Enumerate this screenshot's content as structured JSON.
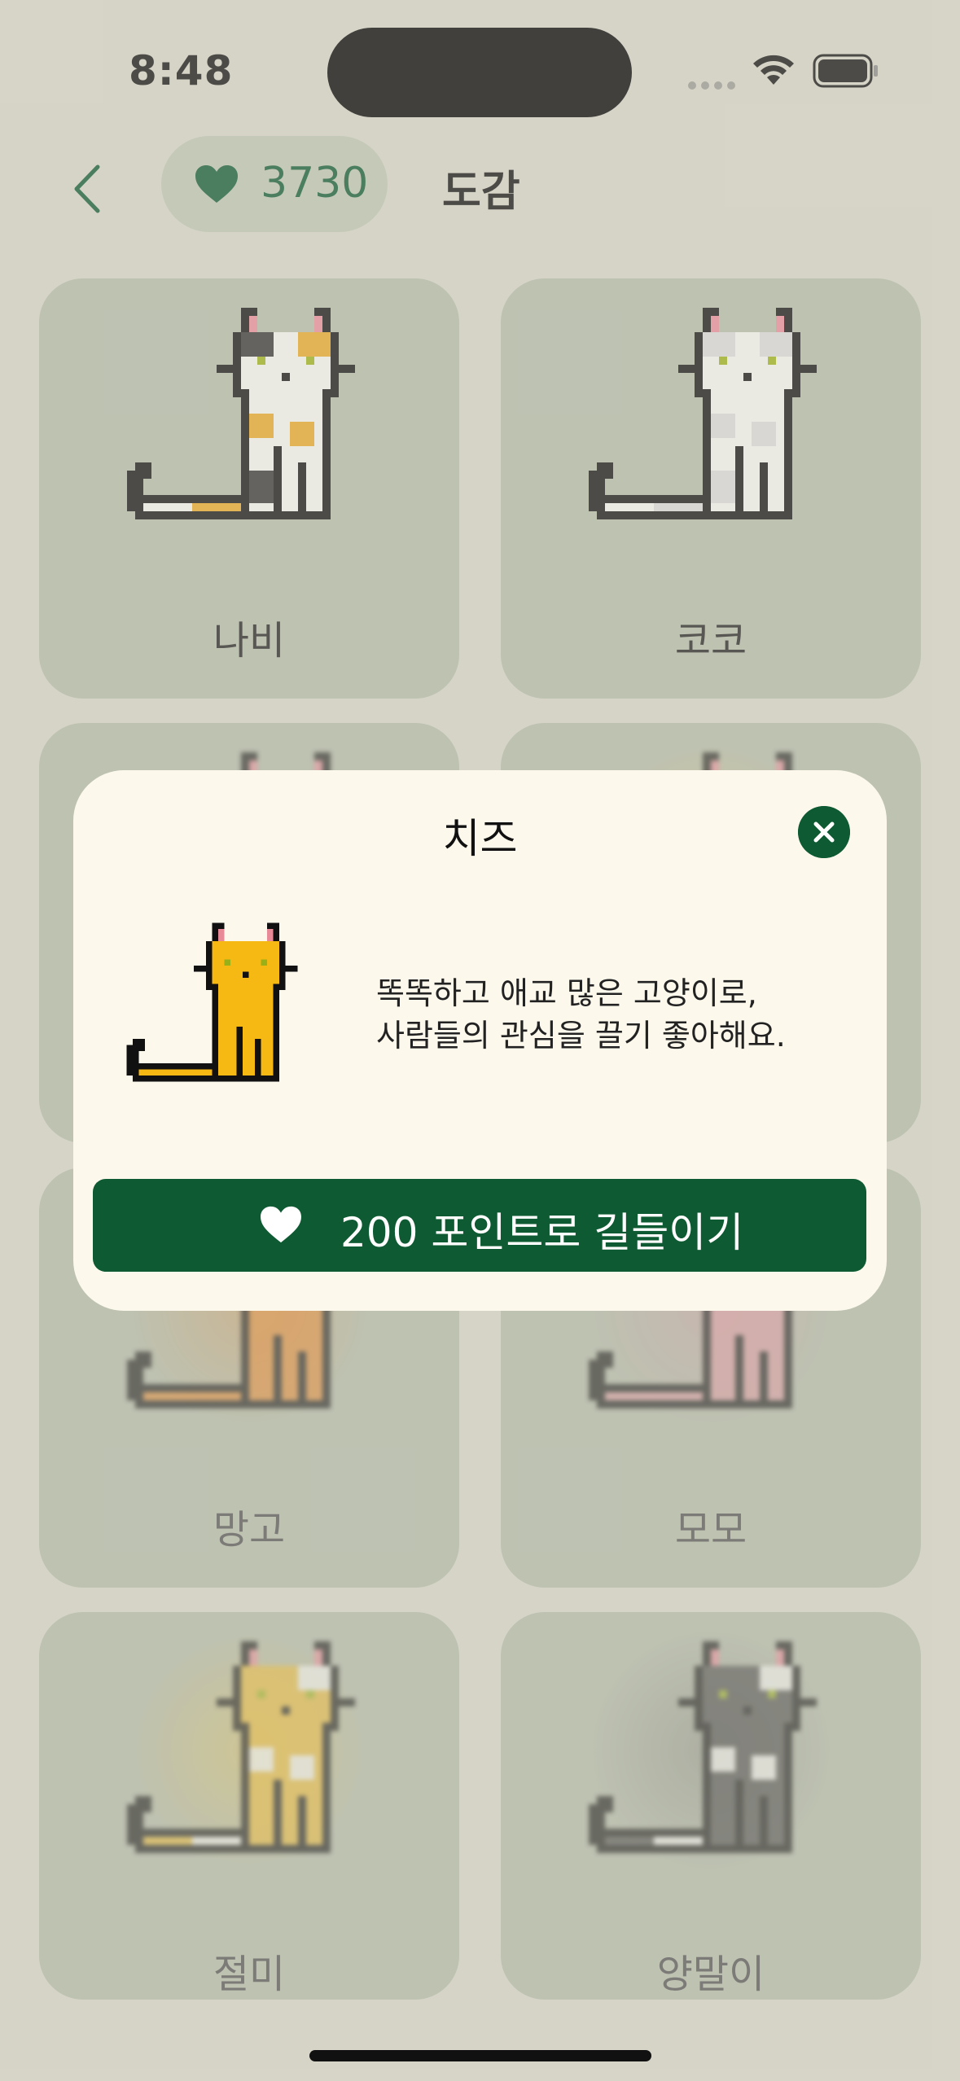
{
  "status_bar": {
    "time": "8:48"
  },
  "header": {
    "points": "3730",
    "title": "도감"
  },
  "cards": [
    {
      "name": "나비",
      "palette": "calico"
    },
    {
      "name": "코코",
      "palette": "white"
    },
    {
      "name": "",
      "palette": "tux"
    },
    {
      "name": "",
      "palette": "cheese"
    },
    {
      "name": "망고",
      "palette": "orange"
    },
    {
      "name": "모모",
      "palette": "pink"
    },
    {
      "name": "절미",
      "palette": "yellow"
    },
    {
      "name": "양말이",
      "palette": "gray"
    }
  ],
  "modal": {
    "title": "치즈",
    "description_line1": "똑똑하고 애교 많은 고양이로,",
    "description_line2": "사람들의 관심을 끌기 좋아해요.",
    "button_label": "200 포인트로 길들이기"
  },
  "colors": {
    "accent": "#0e5a32",
    "background": "#d6d5c8",
    "card": "#b3baa8",
    "modal": "#fcf8ec"
  },
  "icons": [
    "back-chevron-icon",
    "heart-icon",
    "close-icon",
    "wifi-icon",
    "battery-icon"
  ]
}
